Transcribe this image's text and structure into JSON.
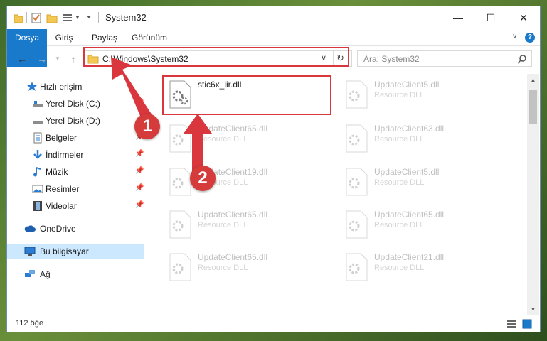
{
  "window": {
    "title": "System32"
  },
  "ribbon": {
    "tabs": [
      "Dosya",
      "Giriş",
      "Paylaş",
      "Görünüm"
    ]
  },
  "address": {
    "path": "C:\\Windows\\System32"
  },
  "search": {
    "placeholder": "Ara: System32"
  },
  "sidebar": {
    "items": [
      {
        "label": "Hızlı erişim",
        "icon": "star-icon"
      },
      {
        "label": "Yerel Disk (C:)",
        "icon": "drive-icon",
        "pinned": true
      },
      {
        "label": "Yerel Disk (D:)",
        "icon": "drive-icon",
        "pinned": true
      },
      {
        "label": "Belgeler",
        "icon": "documents-icon",
        "pinned": true
      },
      {
        "label": "İndirmeler",
        "icon": "downloads-icon",
        "pinned": true
      },
      {
        "label": "Müzik",
        "icon": "music-icon",
        "pinned": true
      },
      {
        "label": "Resimler",
        "icon": "pictures-icon",
        "pinned": true
      },
      {
        "label": "Videolar",
        "icon": "videos-icon",
        "pinned": true
      },
      {
        "label": "OneDrive",
        "icon": "onedrive-icon"
      },
      {
        "label": "Bu bilgisayar",
        "icon": "computer-icon",
        "selected": true
      },
      {
        "label": "Ağ",
        "icon": "network-icon"
      }
    ]
  },
  "files": [
    {
      "name": "stic6x_iir.dll",
      "type": ""
    },
    {
      "name": "UpdateClient5.dll",
      "type": "Resource DLL"
    },
    {
      "name": "UpdateClient65.dll",
      "type": "Resource DLL"
    },
    {
      "name": "UpdateClient63.dll",
      "type": "Resource DLL"
    },
    {
      "name": "UpdateClient19.dll",
      "type": "Resource DLL"
    },
    {
      "name": "UpdateClient5.dll",
      "type": "Resource DLL"
    },
    {
      "name": "UpdateClient65.dll",
      "type": "Resource DLL"
    },
    {
      "name": "UpdateClient65.dll",
      "type": "Resource DLL"
    },
    {
      "name": "UpdateClient65.dll",
      "type": "Resource DLL"
    },
    {
      "name": "UpdateClient21.dll",
      "type": "Resource DLL"
    }
  ],
  "status": {
    "count": "112 öğe"
  },
  "annotations": {
    "badge1": "1",
    "badge2": "2"
  },
  "colors": {
    "accent": "#1979ca",
    "annotation": "#d9363e",
    "selected": "#cce8ff"
  }
}
